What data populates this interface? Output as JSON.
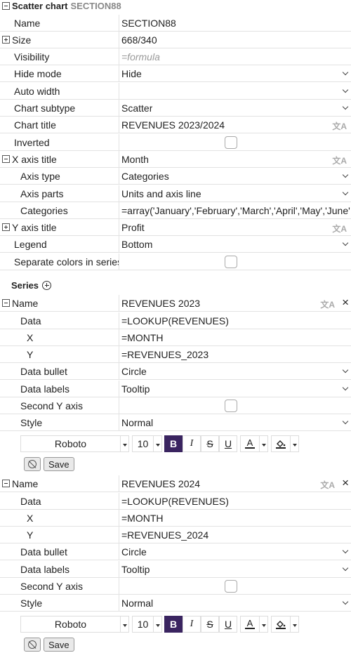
{
  "header": {
    "title": "Scatter chart",
    "name": "SECTION88"
  },
  "props": {
    "name": {
      "label": "Name",
      "value": "SECTION88"
    },
    "size": {
      "label": "Size",
      "value": "668/340"
    },
    "visibility": {
      "label": "Visibility",
      "placeholder": "=formula"
    },
    "hide_mode": {
      "label": "Hide mode",
      "value": "Hide"
    },
    "auto_width": {
      "label": "Auto width",
      "value": ""
    },
    "chart_subtype": {
      "label": "Chart subtype",
      "value": "Scatter"
    },
    "chart_title": {
      "label": "Chart title",
      "value": "REVENUES 2023/2024"
    },
    "inverted": {
      "label": "Inverted",
      "checked": false
    },
    "x_axis_title": {
      "label": "X axis title",
      "value": "Month"
    },
    "axis_type": {
      "label": "Axis type",
      "value": "Categories"
    },
    "axis_parts": {
      "label": "Axis parts",
      "value": "Units and axis line"
    },
    "categories": {
      "label": "Categories",
      "value": "=array('January','February','March','April','May','June','J"
    },
    "y_axis_title": {
      "label": "Y axis title",
      "value": "Profit"
    },
    "legend": {
      "label": "Legend",
      "value": "Bottom"
    },
    "separate_colors": {
      "label": "Separate colors in series",
      "checked": false
    }
  },
  "series_section": {
    "label": "Series"
  },
  "translate_icon": "文A",
  "close_icon": "×",
  "series": [
    {
      "name_label": "Name",
      "name": "REVENUES 2023",
      "data_label": "Data",
      "data": "=LOOKUP(REVENUES)",
      "x_label": "X",
      "x": "=MONTH",
      "y_label": "Y",
      "y": "=REVENUES_2023",
      "bullet_label": "Data bullet",
      "bullet": "Circle",
      "labels_label": "Data labels",
      "labels": "Tooltip",
      "second_y_label": "Second Y axis",
      "second_y": false,
      "style_label": "Style",
      "style": "Normal",
      "font": "Roboto",
      "font_size": "10",
      "bold": "B",
      "italic": "I",
      "strike": "S",
      "underline": "U",
      "font_color_icon": "A",
      "save_label": "Save"
    },
    {
      "name_label": "Name",
      "name": "REVENUES 2024",
      "data_label": "Data",
      "data": "=LOOKUP(REVENUES)",
      "x_label": "X",
      "x": "=MONTH",
      "y_label": "Y",
      "y": "=REVENUES_2024",
      "bullet_label": "Data bullet",
      "bullet": "Circle",
      "labels_label": "Data labels",
      "labels": "Tooltip",
      "second_y_label": "Second Y axis",
      "second_y": false,
      "style_label": "Style",
      "style": "Normal",
      "font": "Roboto",
      "font_size": "10",
      "bold": "B",
      "italic": "I",
      "strike": "S",
      "underline": "U",
      "font_color_icon": "A",
      "save_label": "Save"
    }
  ]
}
